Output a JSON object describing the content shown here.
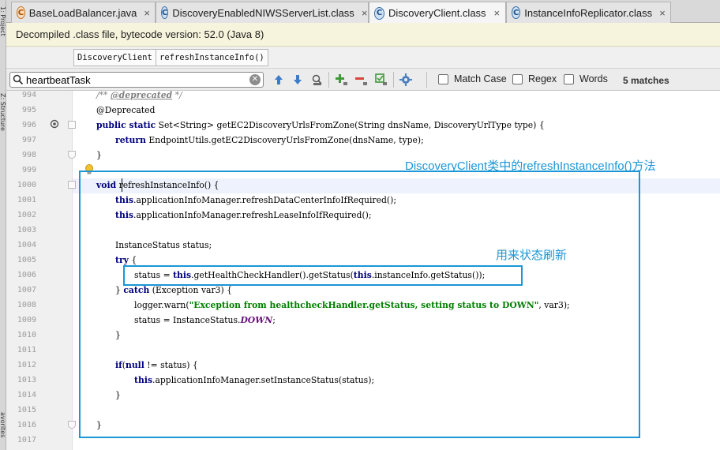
{
  "tabs": [
    {
      "label": "BaseLoadBalancer.java",
      "icon": "java-file-icon",
      "active": false
    },
    {
      "label": "DiscoveryEnabledNIWSServerList.class",
      "icon": "class-file-icon",
      "active": false
    },
    {
      "label": "DiscoveryClient.class",
      "icon": "class-file-icon",
      "active": true
    },
    {
      "label": "InstanceInfoReplicator.class",
      "icon": "class-file-icon",
      "active": false
    }
  ],
  "tool_windows": {
    "project": "1: Project",
    "structure": "Z: Structure",
    "favorites": "avorites"
  },
  "banner": "Decompiled .class file, bytecode version: 52.0 (Java 8)",
  "breadcrumbs": [
    "DiscoveryClient",
    "refreshInstanceInfo()"
  ],
  "search": {
    "value": "heartbeatTask",
    "options": [
      "Match Case",
      "Regex",
      "Words"
    ],
    "matches": "5 matches"
  },
  "editor": {
    "current_line": "1000",
    "lines": [
      {
        "n": "994"
      },
      {
        "n": "995"
      },
      {
        "n": "996"
      },
      {
        "n": "997"
      },
      {
        "n": "998"
      },
      {
        "n": "999"
      },
      {
        "n": "1000"
      },
      {
        "n": "1001"
      },
      {
        "n": "1002"
      },
      {
        "n": "1003"
      },
      {
        "n": "1004"
      },
      {
        "n": "1005"
      },
      {
        "n": "1006"
      },
      {
        "n": "1007"
      },
      {
        "n": "1008"
      },
      {
        "n": "1009"
      },
      {
        "n": "1010"
      },
      {
        "n": "1011"
      },
      {
        "n": "1012"
      },
      {
        "n": "1013"
      },
      {
        "n": "1014"
      },
      {
        "n": "1015"
      },
      {
        "n": "1016"
      },
      {
        "n": "1017"
      }
    ],
    "code": {
      "l994_a": "/** ",
      "l994_b": "@deprecated",
      "l994_c": " */",
      "l995": "@Deprecated",
      "l996_kw": "public static",
      "l996_rest": " Set<String> getEC2DiscoveryUrlsFromZone(String dnsName, DiscoveryUrlType type) {",
      "l997_kw": "return",
      "l997_rest": " EndpointUtils.getEC2DiscoveryUrlsFromZone(dnsName, type);",
      "l998": "}",
      "l1000_kw": "void",
      "l1000_rest": " refreshInstanceInfo() {",
      "this": "this",
      "l1001_rest": ".applicationInfoManager.refreshDataCenterInfoIfRequired();",
      "l1002_rest": ".applicationInfoManager.refreshLeaseInfoIfRequired();",
      "l1004": "InstanceStatus status;",
      "l1005_kw": "try",
      "l1005_rest": " {",
      "l1006_a": "status = ",
      "l1006_b": ".getHealthCheckHandler().getStatus(",
      "l1006_c": ".instanceInfo.getStatus());",
      "l1007_a": "} ",
      "l1007_kw": "catch",
      "l1007_b": " (Exception var3) {",
      "l1008_a": "logger.warn(",
      "l1008_str": "\"Exception from healthcheckHandler.getStatus, setting status to DOWN\"",
      "l1008_b": ", var3);",
      "l1009_a": "status = InstanceStatus.",
      "l1009_fld": "DOWN",
      "l1009_b": ";",
      "l1010": "}",
      "l1012_kw": "if",
      "l1012_a": "(",
      "l1012_null": "null",
      "l1012_b": " != status) {",
      "l1013_rest": ".applicationInfoManager.setInstanceStatus(status);",
      "l1014": "}",
      "l1016": "}"
    }
  },
  "annotations": {
    "method_note": "DiscoveryClient类中的refreshInstanceInfo()方法",
    "status_note": "用来状态刷新"
  },
  "colors": {
    "annotation": "#1b96d6",
    "keyword": "#000080",
    "string": "#008000",
    "field": "#660e7a"
  }
}
